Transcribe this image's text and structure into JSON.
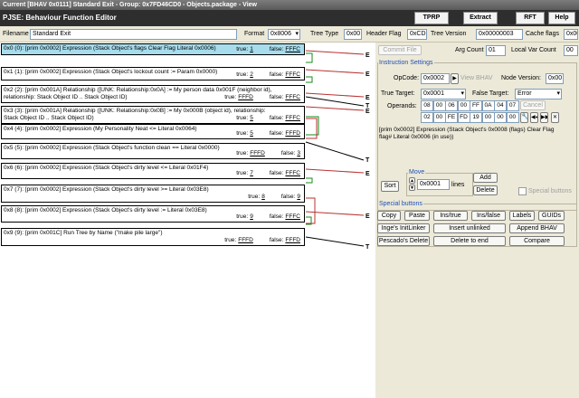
{
  "window": {
    "title": "Current [BHAV 0x0111] Standard Exit - Group: 0x7FD46CD0 - Objects.package - View",
    "header": "PJSE: Behaviour Function Editor",
    "buttons": {
      "tprp": "TPRP",
      "extract": "Extract",
      "rft": "RFT",
      "help": "Help"
    }
  },
  "toolbar": {
    "filename_label": "Filename",
    "filename_value": "Standard Exit",
    "format_label": "Format",
    "format_value": "0x8006",
    "tree_type_label": "Tree Type",
    "tree_type_value": "0x00",
    "header_flag_label": "Header Flag",
    "header_flag_value": "0xCD",
    "tree_version_label": "Tree Version",
    "tree_version_value": "0x00000003",
    "cache_flags_label": "Cache flags",
    "cache_flags_value": "0x00"
  },
  "nodes": [
    {
      "title": "0x0 (0): [prim 0x0002] Expression (Stack Object's flags Clear Flag Literal 0x0006)",
      "true_label": "true:",
      "true_val": "1",
      "false_label": "false:",
      "false_val": "FFFC",
      "selected": true
    },
    {
      "title": "0x1 (1): [prim 0x0002] Expression (Stack Object's lockout count := Param 0x0000)",
      "true_label": "true:",
      "true_val": "2",
      "false_label": "false:",
      "false_val": "FFFC"
    },
    {
      "title": "0x2 (2): [prim 0x001A] Relationship ([UNK: Relationship:0x0A] := My person data 0x001F (neighbor id),\nrelationship: Stack Object ID .. Stack Object ID)",
      "true_label": "true:",
      "true_val": "FFFD",
      "false_label": "false:",
      "false_val": "FFFC"
    },
    {
      "title": "0x3 (3): [prim 0x001A] Relationship ([UNK: Relationship:0x0B] := My 0x000B (object id), relationship:\nStack Object ID .. Stack Object ID)",
      "true_label": "true:",
      "true_val": "5",
      "false_label": "false:",
      "false_val": "FFFC"
    },
    {
      "title": "0x4 (4): [prim 0x0002] Expression (My Personality Neat <= Literal 0x0064)",
      "true_label": "true:",
      "true_val": "5",
      "false_label": "false:",
      "false_val": "FFFD"
    },
    {
      "title": "0x5 (5): [prim 0x0002] Expression (Stack Object's function clean == Literal 0x0000)",
      "true_label": "true:",
      "true_val": "FFFD",
      "false_label": "false:",
      "false_val": "3"
    },
    {
      "title": "0x6 (6): [prim 0x0002] Expression (Stack Object's dirty level <= Literal 0x01F4)",
      "true_label": "true:",
      "true_val": "7",
      "false_label": "false:",
      "false_val": "FFFC"
    },
    {
      "title": "0x7 (7): [prim 0x0002] Expression (Stack Object's dirty level >= Literal 0x03E8)",
      "true_label": "true:",
      "true_val": "8",
      "false_label": "false:",
      "false_val": "9"
    },
    {
      "title": "0x8 (8): [prim 0x0002] Expression (Stack Object's dirty level := Literal 0x03E8)",
      "true_label": "true:",
      "true_val": "9",
      "false_label": "false:",
      "false_val": "FFFC"
    },
    {
      "title": "0x9 (9): [prim 0x001C] Run Tree by Name (\"make pile large\")",
      "true_label": "true:",
      "true_val": "FFFD",
      "false_label": "false:",
      "false_val": "FFFD"
    }
  ],
  "graph_labels": {
    "error": "E",
    "true": "T"
  },
  "panel": {
    "commit_file": "Commit File",
    "arg_count_label": "Arg Count",
    "arg_count_value": "01",
    "local_var_label": "Local Var Count",
    "local_var_value": "00",
    "instruction_settings": "Instruction Settings",
    "opcode_label": "OpCode:",
    "opcode_value": "0x0002",
    "view_bhav": "View BHAV",
    "node_version_label": "Node Version:",
    "node_version_value": "0x00",
    "true_target_label": "True Target:",
    "true_target_value": "0x0001",
    "false_target_label": "False Target:",
    "false_target_value": "Error",
    "operands_label": "Operands:",
    "operands_row1": [
      "08",
      "00",
      "06",
      "00",
      "FF",
      "0A",
      "04",
      "07"
    ],
    "operands_row2": [
      "02",
      "00",
      "FE",
      "FD",
      "19",
      "00",
      "00",
      "00"
    ],
    "cancel": "Cancel",
    "description": "[prim 0x0002] Expression (Stack Object's 0x0008 (flags) Clear Flag\nflag# Literal 0x0006 (in use))",
    "sort": "Sort",
    "move_label": "Move",
    "move_value": "0x0001",
    "lines": "lines",
    "add": "Add",
    "delete": "Delete",
    "special_buttons_chk": "Special buttons",
    "special_buttons": "Special buttons",
    "row1": [
      "Copy",
      "Paste",
      "Ins/true",
      "Ins/false",
      "Labels",
      "GUIDs"
    ],
    "row2": [
      "Inge's InitLinker",
      "Insert unlinked",
      "Append BHAV"
    ],
    "row3": [
      "Pescado's Delete",
      "Delete to end",
      "Compare"
    ]
  }
}
